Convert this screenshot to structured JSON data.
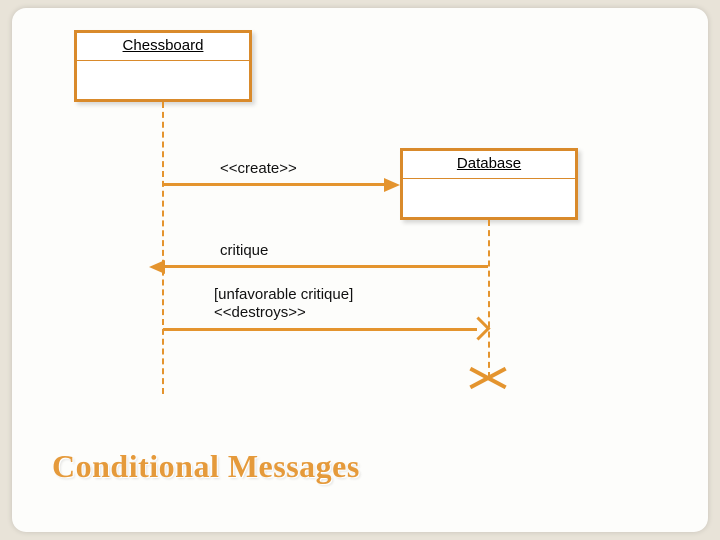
{
  "objects": {
    "left": "Chessboard",
    "right": "Database"
  },
  "messages": {
    "create": "<<create>>",
    "critique": "critique",
    "destroy_guard": "[unfavorable critique]",
    "destroy": "<<destroys>>"
  },
  "title": "Conditional Messages"
}
